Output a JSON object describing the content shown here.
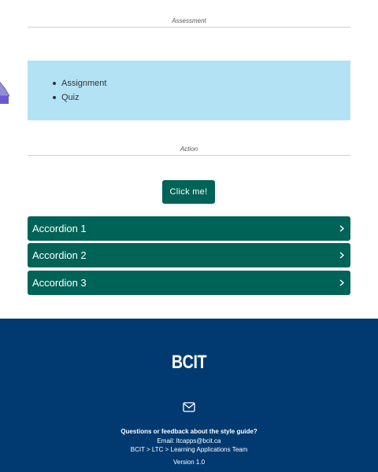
{
  "sections": {
    "assessment_label": "Assessment",
    "action_label": "Action"
  },
  "assessment": {
    "items": [
      "Assignment",
      "Quiz"
    ],
    "background": "#b3e2f5"
  },
  "action": {
    "button_label": "Click me!",
    "button_color": "#006357"
  },
  "accordions": [
    {
      "label": "Accordion 1",
      "icon": "chevron-right-icon"
    },
    {
      "label": "Accordion 2",
      "icon": "chevron-right-icon"
    },
    {
      "label": "Accordion 3",
      "icon": "chevron-right-icon"
    }
  ],
  "footer": {
    "background": "#003a70",
    "logo_text": "BCIT",
    "mail_icon": "envelope-icon",
    "question": "Questions or feedback about the style guide?",
    "email": "Email: ltcapps@bcit.ca",
    "breadcrumb": "BCIT > LTC > Learning Applications Team",
    "version": "Version 1.0"
  }
}
